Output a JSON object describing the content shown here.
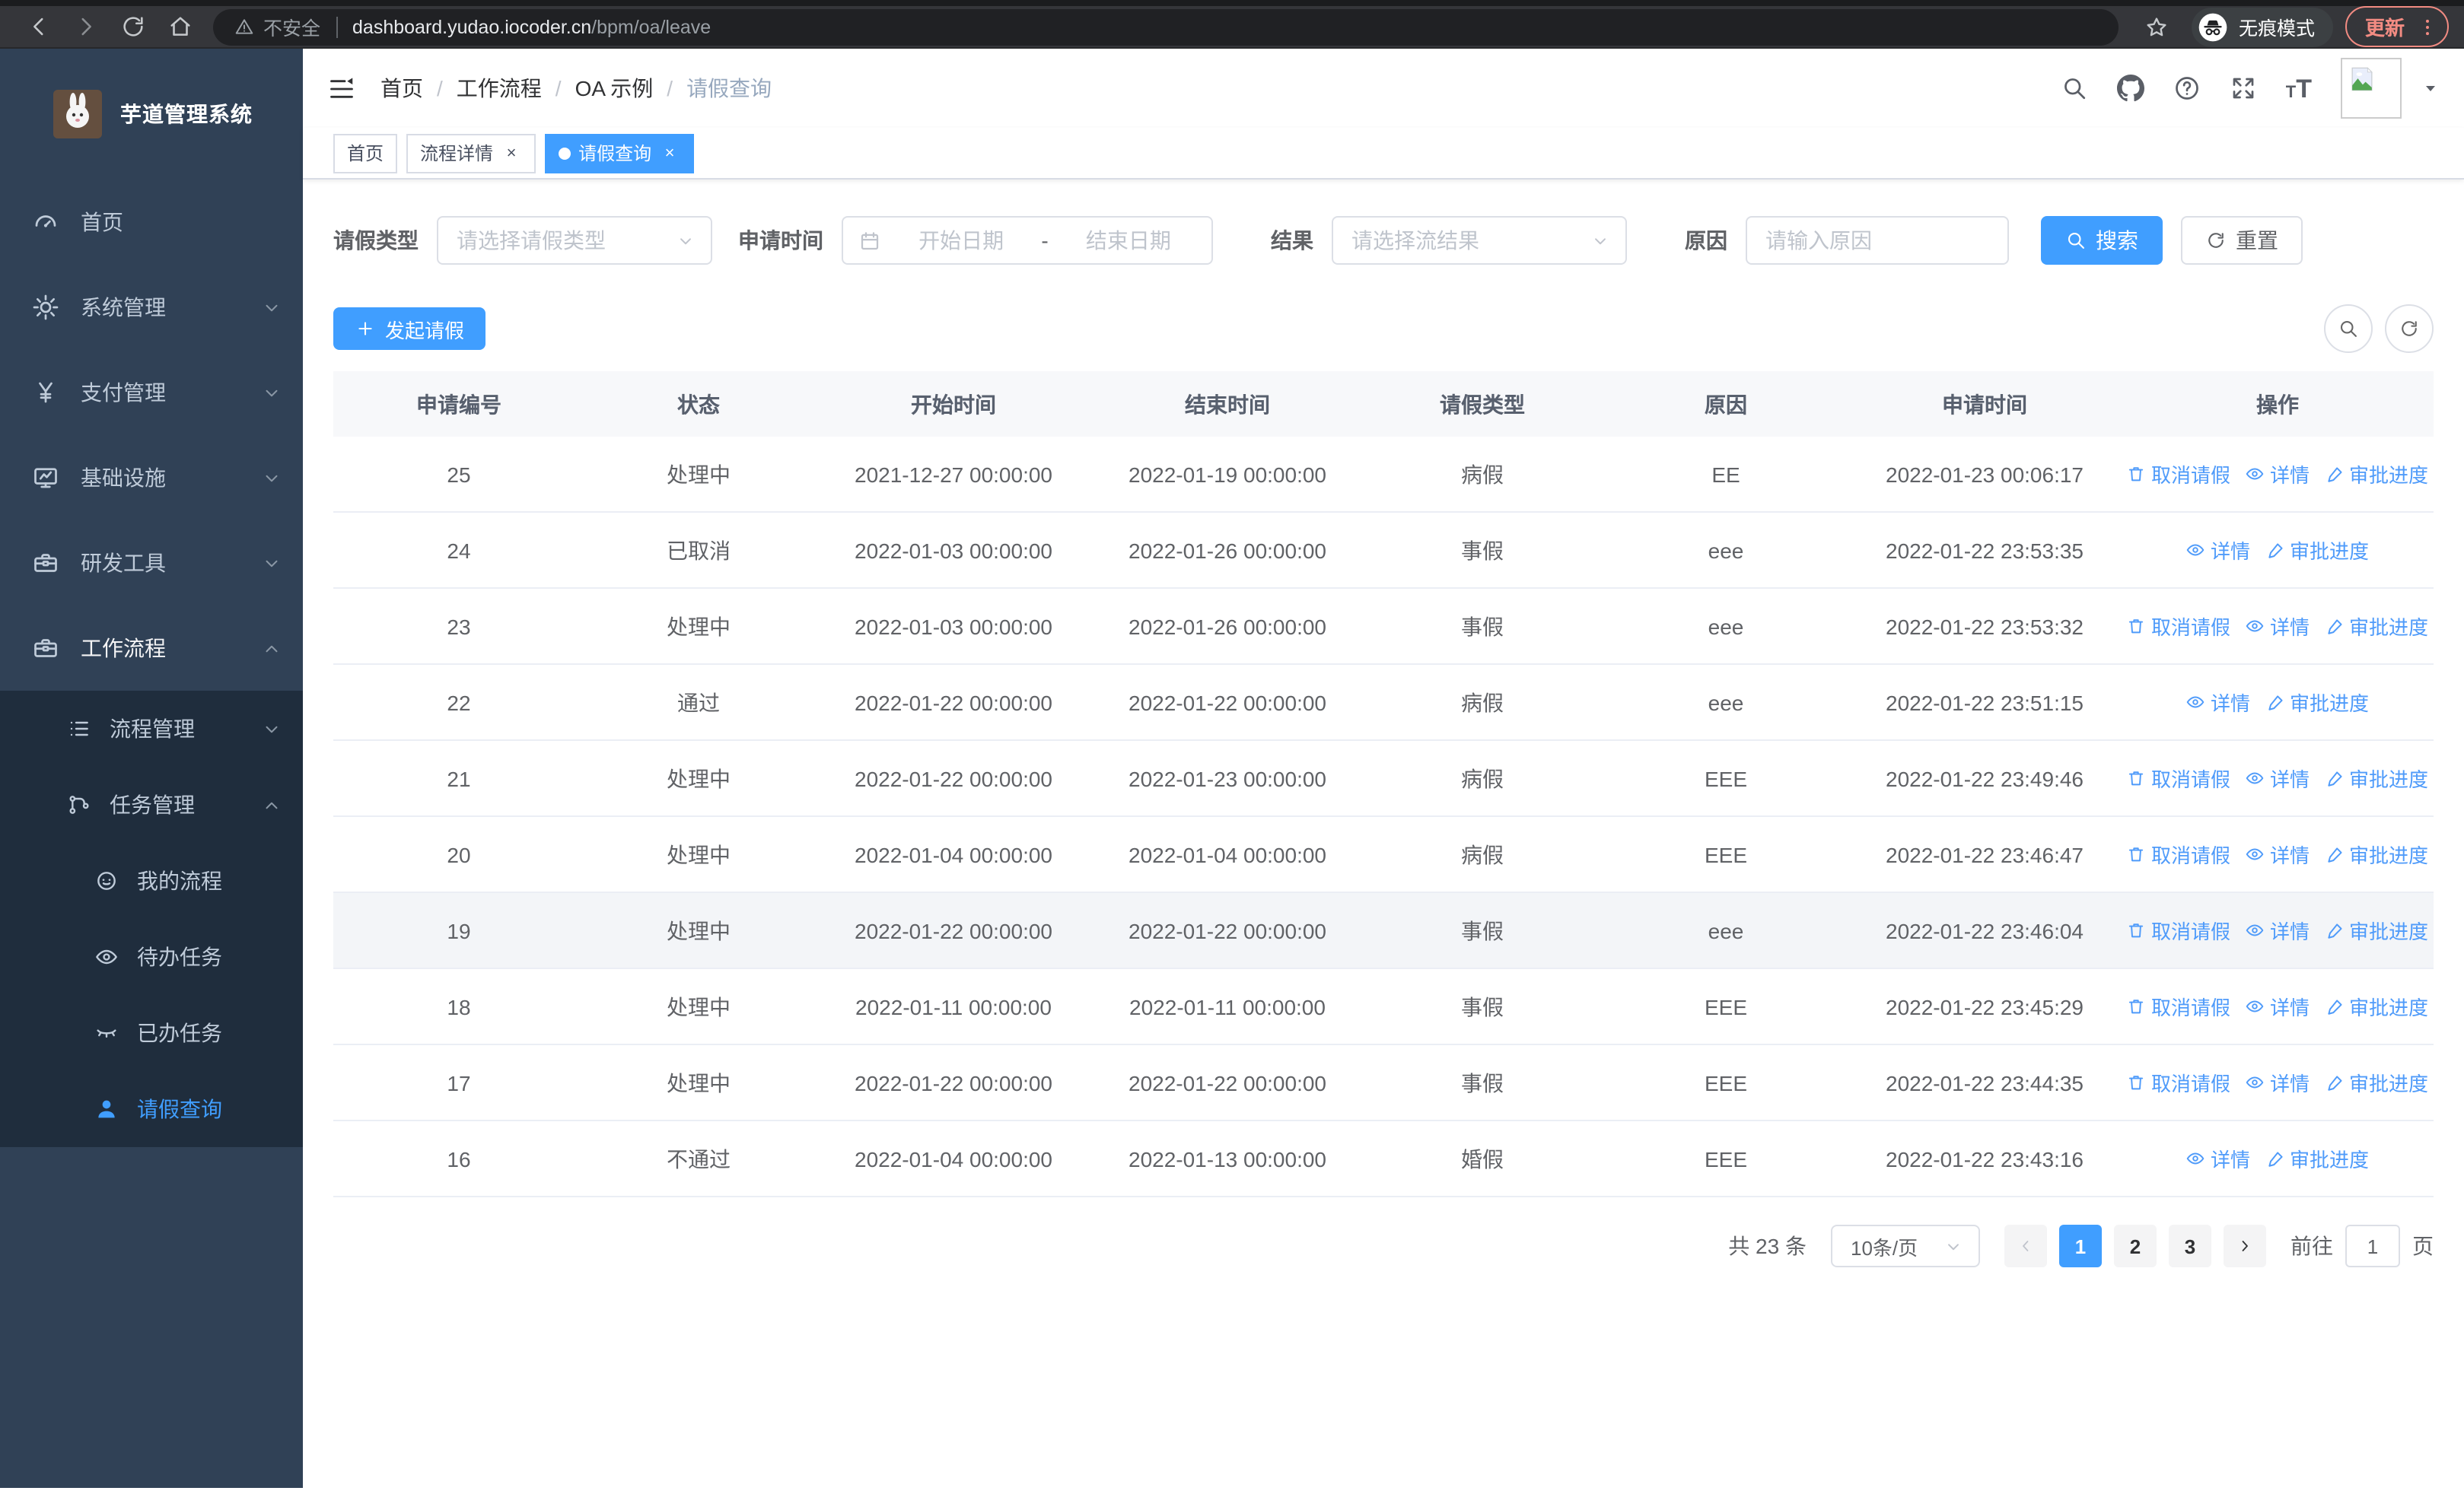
{
  "browser": {
    "security_label": "不安全",
    "url_host": "dashboard.yudao.iocoder.cn",
    "url_path": "/bpm/oa/leave",
    "incognito_label": "无痕模式",
    "update_label": "更新"
  },
  "sidebar": {
    "title": "芋道管理系统",
    "menu": [
      {
        "label": "首页",
        "icon": "gauge",
        "chevron": null
      },
      {
        "label": "系统管理",
        "icon": "gear",
        "chevron": "down"
      },
      {
        "label": "支付管理",
        "icon": "yen",
        "chevron": "down"
      },
      {
        "label": "基础设施",
        "icon": "monitor",
        "chevron": "down"
      },
      {
        "label": "研发工具",
        "icon": "toolbox",
        "chevron": "down"
      },
      {
        "label": "工作流程",
        "icon": "briefcase",
        "chevron": "up",
        "active_parent": true
      }
    ],
    "submenu": [
      {
        "label": "流程管理",
        "icon": "tree",
        "chevron": "down",
        "level": 2
      },
      {
        "label": "任务管理",
        "icon": "flow",
        "chevron": "up",
        "level": 2,
        "active_parent": true
      },
      {
        "label": "我的流程",
        "icon": "face",
        "level": 3
      },
      {
        "label": "待办任务",
        "icon": "eye",
        "level": 3
      },
      {
        "label": "已办任务",
        "icon": "eye-off",
        "level": 3
      },
      {
        "label": "请假查询",
        "icon": "user",
        "level": 3,
        "active": true
      }
    ]
  },
  "header": {
    "breadcrumb": [
      "首页",
      "工作流程",
      "OA 示例",
      "请假查询"
    ],
    "tabs": [
      {
        "label": "首页",
        "closable": false,
        "active": false
      },
      {
        "label": "流程详情",
        "closable": true,
        "active": false
      },
      {
        "label": "请假查询",
        "closable": true,
        "active": true
      }
    ]
  },
  "filters": {
    "type_label": "请假类型",
    "type_placeholder": "请选择请假类型",
    "time_label": "申请时间",
    "start_placeholder": "开始日期",
    "range_separator": "-",
    "end_placeholder": "结束日期",
    "result_label": "结果",
    "result_placeholder": "请选择流结果",
    "reason_label": "原因",
    "reason_placeholder": "请输入原因",
    "search_label": "搜索",
    "reset_label": "重置"
  },
  "toolbar": {
    "create_label": "发起请假"
  },
  "table": {
    "columns": [
      "申请编号",
      "状态",
      "开始时间",
      "结束时间",
      "请假类型",
      "原因",
      "申请时间",
      "操作"
    ],
    "action_labels": {
      "cancel": "取消请假",
      "detail": "详情",
      "audit": "审批进度"
    },
    "rows": [
      {
        "id": "25",
        "status": "处理中",
        "start": "2021-12-27 00:00:00",
        "end": "2022-01-19 00:00:00",
        "type": "病假",
        "reason": "EE",
        "applied": "2022-01-23 00:06:17",
        "can_cancel": true,
        "highlight": false
      },
      {
        "id": "24",
        "status": "已取消",
        "start": "2022-01-03 00:00:00",
        "end": "2022-01-26 00:00:00",
        "type": "事假",
        "reason": "eee",
        "applied": "2022-01-22 23:53:35",
        "can_cancel": false,
        "highlight": false
      },
      {
        "id": "23",
        "status": "处理中",
        "start": "2022-01-03 00:00:00",
        "end": "2022-01-26 00:00:00",
        "type": "事假",
        "reason": "eee",
        "applied": "2022-01-22 23:53:32",
        "can_cancel": true,
        "highlight": false
      },
      {
        "id": "22",
        "status": "通过",
        "start": "2022-01-22 00:00:00",
        "end": "2022-01-22 00:00:00",
        "type": "病假",
        "reason": "eee",
        "applied": "2022-01-22 23:51:15",
        "can_cancel": false,
        "highlight": false
      },
      {
        "id": "21",
        "status": "处理中",
        "start": "2022-01-22 00:00:00",
        "end": "2022-01-23 00:00:00",
        "type": "病假",
        "reason": "EEE",
        "applied": "2022-01-22 23:49:46",
        "can_cancel": true,
        "highlight": false
      },
      {
        "id": "20",
        "status": "处理中",
        "start": "2022-01-04 00:00:00",
        "end": "2022-01-04 00:00:00",
        "type": "病假",
        "reason": "EEE",
        "applied": "2022-01-22 23:46:47",
        "can_cancel": true,
        "highlight": false
      },
      {
        "id": "19",
        "status": "处理中",
        "start": "2022-01-22 00:00:00",
        "end": "2022-01-22 00:00:00",
        "type": "事假",
        "reason": "eee",
        "applied": "2022-01-22 23:46:04",
        "can_cancel": true,
        "highlight": true
      },
      {
        "id": "18",
        "status": "处理中",
        "start": "2022-01-11 00:00:00",
        "end": "2022-01-11 00:00:00",
        "type": "事假",
        "reason": "EEE",
        "applied": "2022-01-22 23:45:29",
        "can_cancel": true,
        "highlight": false
      },
      {
        "id": "17",
        "status": "处理中",
        "start": "2022-01-22 00:00:00",
        "end": "2022-01-22 00:00:00",
        "type": "事假",
        "reason": "EEE",
        "applied": "2022-01-22 23:44:35",
        "can_cancel": true,
        "highlight": false
      },
      {
        "id": "16",
        "status": "不通过",
        "start": "2022-01-04 00:00:00",
        "end": "2022-01-13 00:00:00",
        "type": "婚假",
        "reason": "EEE",
        "applied": "2022-01-22 23:43:16",
        "can_cancel": false,
        "highlight": false
      }
    ]
  },
  "pagination": {
    "total": "共 23 条",
    "page_size": "10条/页",
    "pages": [
      "1",
      "2",
      "3"
    ],
    "active_page": "1",
    "goto_label": "前往",
    "goto_value": "1",
    "goto_unit": "页"
  },
  "colors": {
    "primary": "#409eff",
    "sidebar_bg": "#304156",
    "submenu_bg": "#1f2d3d",
    "update_accent": "#f28b82"
  }
}
